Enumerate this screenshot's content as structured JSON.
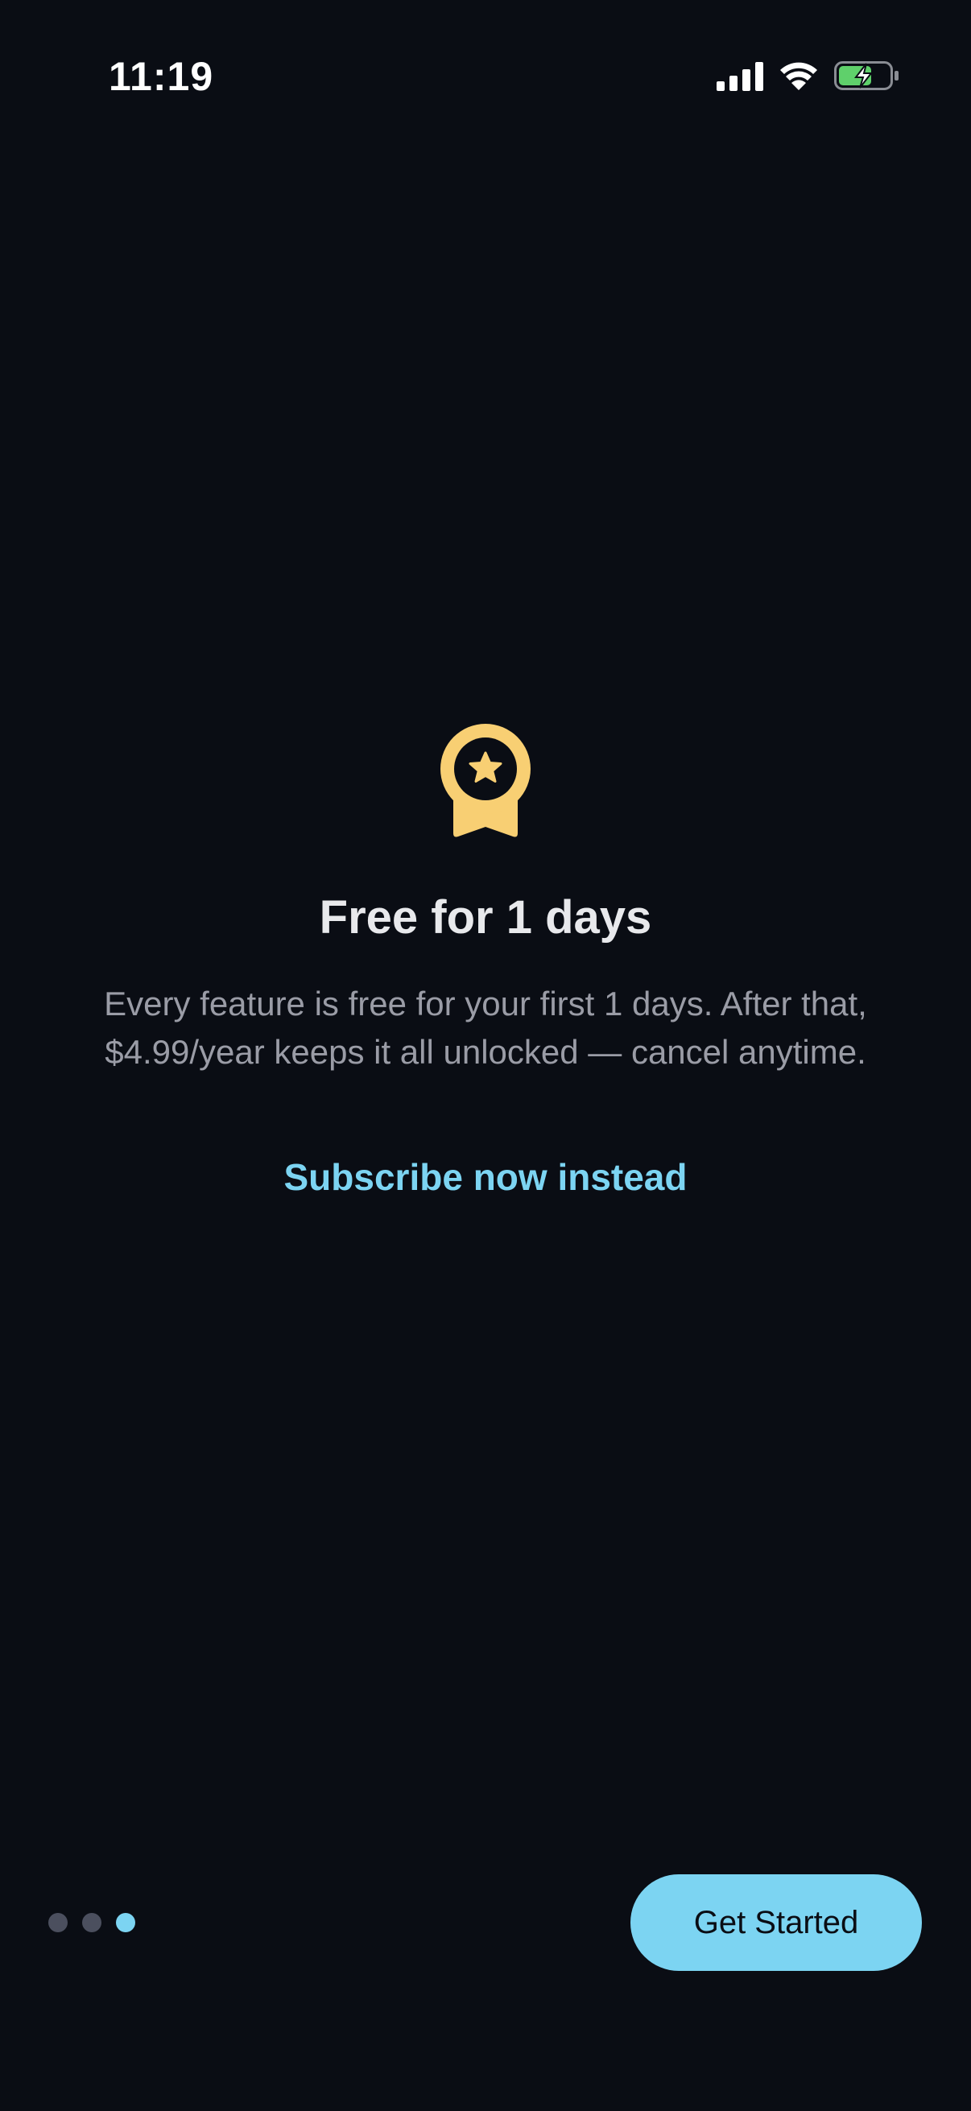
{
  "status_bar": {
    "time": "11:19",
    "icons": [
      "cellular-signal-icon",
      "wifi-icon",
      "battery-charging-icon"
    ]
  },
  "onboarding": {
    "icon": "award-ribbon-icon",
    "title": "Free for 1 days",
    "description": "Every feature is free for your first 1 days. After that, $4.99/year keeps it all unlocked — cancel anytime.",
    "subscribe_link": "Subscribe now instead"
  },
  "pagination": {
    "total": 3,
    "active_index": 2
  },
  "cta": {
    "label": "Get Started"
  },
  "colors": {
    "background": "#0a0d14",
    "accent": "#7cd4f2",
    "icon": "#f8cf73",
    "title": "#e8e9ec",
    "body": "#9a9ca6",
    "dot_inactive": "#4b4f5e",
    "battery": "#5fd06b"
  }
}
